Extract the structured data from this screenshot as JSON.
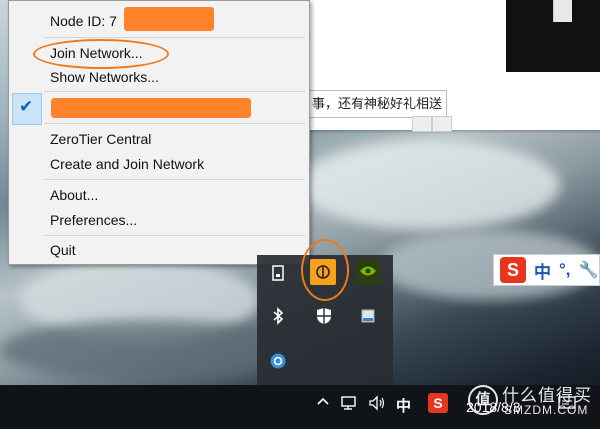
{
  "menu": {
    "node_id_label": "Node ID: 7",
    "items": [
      {
        "label": "Join Network..."
      },
      {
        "label": "Show Networks..."
      },
      {
        "label": "ZeroTier Central"
      },
      {
        "label": "Create and Join Network"
      },
      {
        "label": "About..."
      },
      {
        "label": "Preferences..."
      },
      {
        "label": "Quit"
      }
    ],
    "checked_item_icon": "check-icon"
  },
  "background_window": {
    "input_text": "事，还有神秘好礼相送"
  },
  "tray": {
    "icons": [
      "usb-drive-icon",
      "zerotier-icon",
      "nvidia-icon",
      "bluetooth-icon",
      "windows-defender-icon",
      "network-adapter-icon",
      "zerotier-connect-icon"
    ]
  },
  "ime_bar": {
    "logo": "S",
    "lang": "中",
    "punct": "°,",
    "tool": "wrench-icon"
  },
  "taskbar": {
    "ime_lang": "中",
    "ime_logo": "S",
    "date": "2018/8/3",
    "icons": [
      "chevron-up-icon",
      "network-icon",
      "volume-icon",
      "notifications-icon"
    ]
  },
  "watermark": {
    "line1": "什么值得买",
    "line2": "SMZDM.COM"
  },
  "colors": {
    "menu_bg": "#f2f2f2",
    "annotation": "#f07a1a",
    "taskbar": "#101418"
  }
}
